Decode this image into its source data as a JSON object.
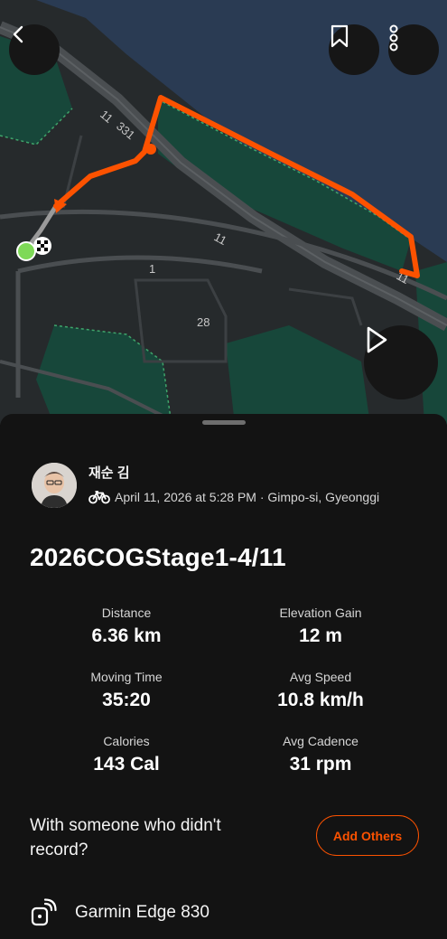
{
  "map": {
    "road_labels": [
      "11",
      "331",
      "11",
      "11",
      "1",
      "28"
    ],
    "route_color": "#fc5200",
    "start_color": "#7ed957"
  },
  "header": {
    "back_icon": "chevron-left-icon",
    "bookmark_icon": "bookmark-icon",
    "more_icon": "more-vertical-icon",
    "play_icon": "play-icon"
  },
  "athlete": {
    "name": "재순 김",
    "activity_icon": "bike-icon",
    "datetime_location": "April 11, 2026 at 5:28 PM · Gimpo-si, Gyeonggi"
  },
  "activity": {
    "title": "2026COGStage1-4/11"
  },
  "stats": {
    "distance": {
      "label": "Distance",
      "value": "6.36 km"
    },
    "elevation_gain": {
      "label": "Elevation Gain",
      "value": "12 m"
    },
    "moving_time": {
      "label": "Moving Time",
      "value": "35:20"
    },
    "avg_speed": {
      "label": "Avg Speed",
      "value": "10.8 km/h"
    },
    "calories": {
      "label": "Calories",
      "value": "143 Cal"
    },
    "avg_cadence": {
      "label": "Avg Cadence",
      "value": "31 rpm"
    }
  },
  "group": {
    "prompt": "With someone who didn't record?",
    "button_label": "Add Others"
  },
  "device": {
    "icon": "device-icon",
    "name": "Garmin Edge 830"
  },
  "colors": {
    "accent": "#fc5200",
    "background": "#131313"
  }
}
